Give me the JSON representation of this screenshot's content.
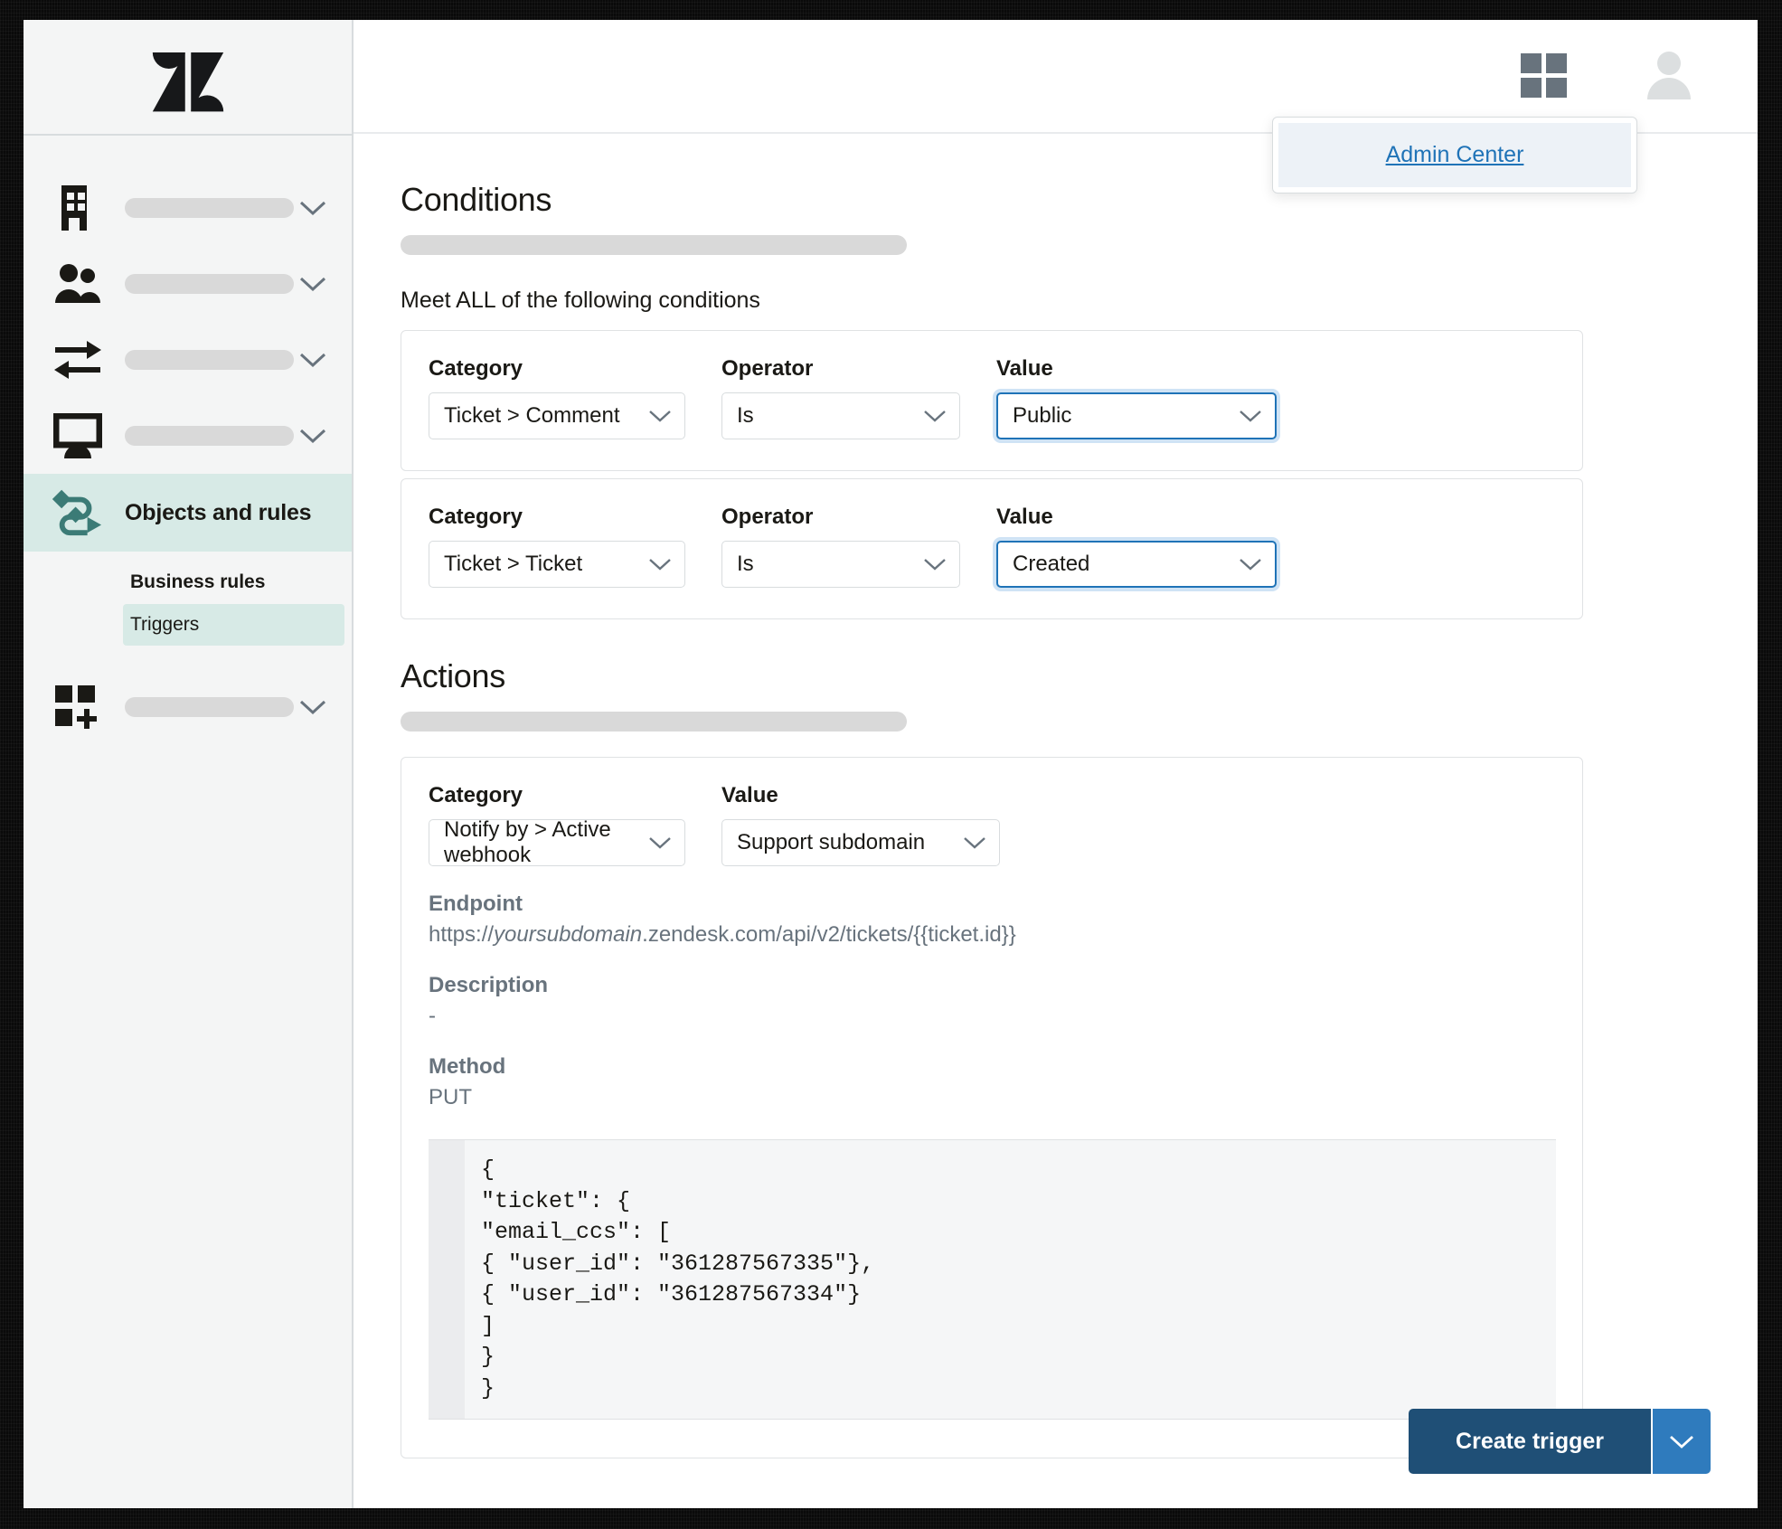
{
  "sidebar": {
    "logo_name": "zendesk-logo",
    "items": [
      {
        "icon": "building-icon",
        "label": "",
        "has_chevron": true
      },
      {
        "icon": "people-icon",
        "label": "",
        "has_chevron": true
      },
      {
        "icon": "arrows-exchange-icon",
        "label": "",
        "has_chevron": true
      },
      {
        "icon": "monitor-icon",
        "label": "",
        "has_chevron": true
      }
    ],
    "active_item": {
      "icon": "objects-rules-icon",
      "label": "Objects and rules"
    },
    "sub_heading": "Business rules",
    "sub_item": "Triggers",
    "last_item": {
      "icon": "apps-add-icon",
      "label": "",
      "has_chevron": true
    }
  },
  "topbar": {
    "products_icon": "grid-icon",
    "avatar_icon": "user-avatar-icon",
    "popup": {
      "link_label": "Admin Center"
    }
  },
  "conditions": {
    "title": "Conditions",
    "meet_text": "Meet ALL of the following conditions",
    "labels": {
      "category": "Category",
      "operator": "Operator",
      "value": "Value"
    },
    "rows": [
      {
        "category": "Ticket > Comment",
        "operator": "Is",
        "value": "Public",
        "value_focused": true
      },
      {
        "category": "Ticket > Ticket",
        "operator": "Is",
        "value": "Created",
        "value_focused": true
      }
    ]
  },
  "actions": {
    "title": "Actions",
    "labels": {
      "category": "Category",
      "value": "Value"
    },
    "category": "Notify by > Active webhook",
    "value": "Support subdomain",
    "endpoint_label": "Endpoint",
    "endpoint_prefix": "https://",
    "endpoint_emphasis": "yoursubdomain",
    "endpoint_suffix": ".zendesk.com/api/v2/tickets/{{ticket.id}}",
    "description_label": "Description",
    "description_value": "-",
    "method_label": "Method",
    "method_value": "PUT",
    "body": "{\n\"ticket\": {\n\"email_ccs\": [\n{ \"user_id\": \"361287567335\"},\n{ \"user_id\": \"361287567334\"}\n]\n}\n}"
  },
  "footer": {
    "create_label": "Create trigger",
    "caret_icon": "chevron-down-icon"
  },
  "colors": {
    "accent_teal": "#3b7b76",
    "active_bg": "#d7eae6",
    "focus_blue": "#1f73b7",
    "primary_button": "#1f4f76",
    "caret_button": "#2f7bbd",
    "link_blue": "#1f73b7",
    "muted_text": "#68737d"
  }
}
